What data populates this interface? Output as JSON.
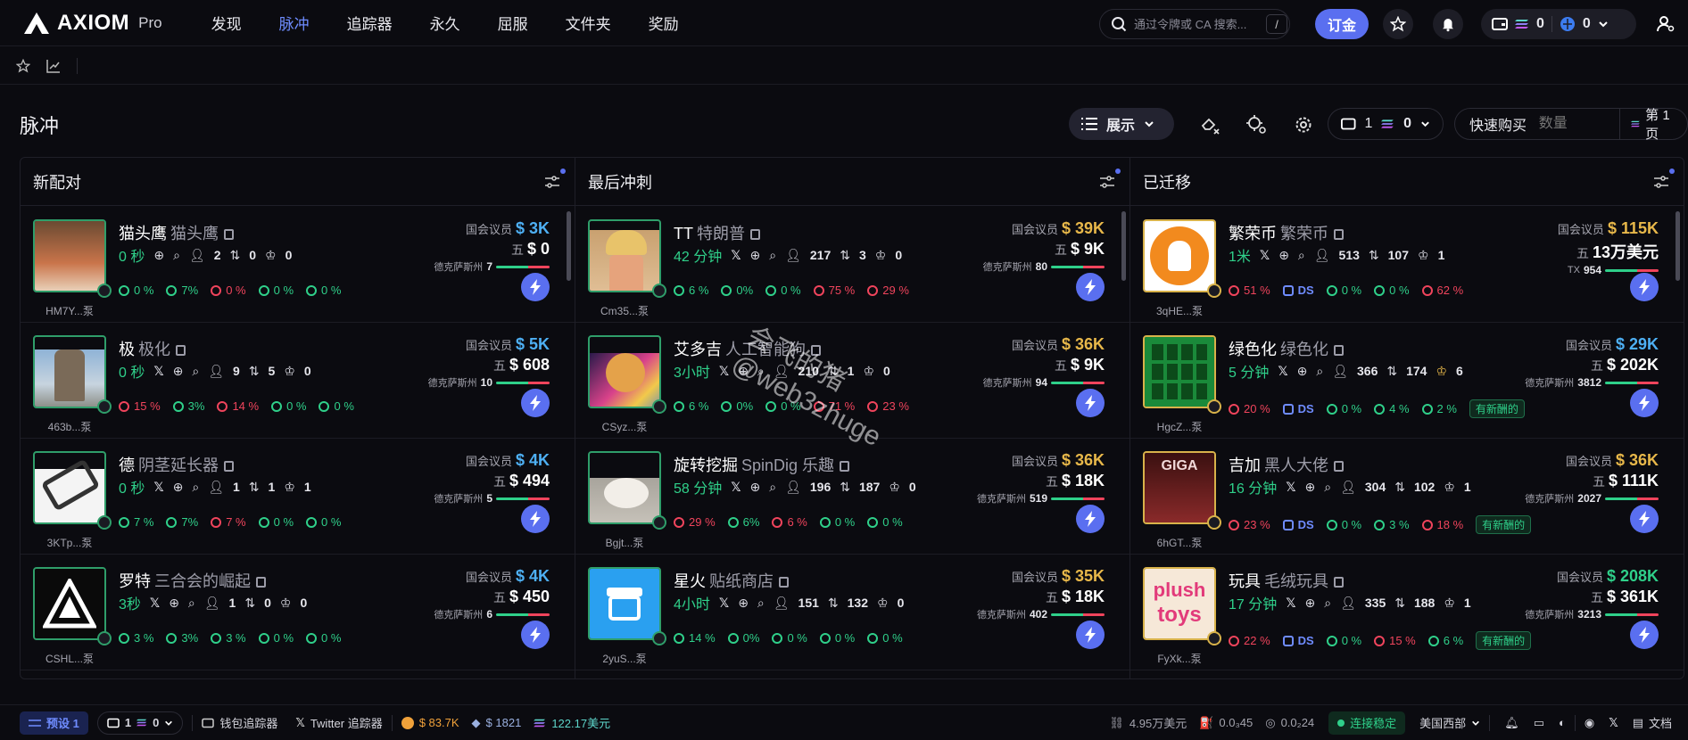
{
  "brand": {
    "name": "AXIOM",
    "suffix": "Pro"
  },
  "nav": [
    "发现",
    "脉冲",
    "追踪器",
    "永久",
    "屈服",
    "文件夹",
    "奖励"
  ],
  "search": {
    "placeholder": "通过令牌或 CA 搜索...",
    "shortcut": "/"
  },
  "header": {
    "deposit": "订金",
    "wallet_sol": "0",
    "wallet_other": "0"
  },
  "page": {
    "title": "脉冲",
    "display": "展示",
    "preset_count": "1",
    "preset_sol": "0",
    "quick_buy": "快速购买",
    "qty_placeholder": "数量",
    "page_label": "第 1 页"
  },
  "columns": [
    {
      "title": "新配对"
    },
    {
      "title": "最后冲刺"
    },
    {
      "title": "已迁移"
    }
  ],
  "cards": {
    "c0": [
      {
        "sym": "猫头鹰",
        "full": "猫头鹰",
        "age": "0 秒",
        "holders": "2",
        "a": "0",
        "b": "0",
        "cap": "HM7Y...泵",
        "mc_label": "国会议员",
        "mc": "$ 3K",
        "vol_label": "五",
        "vol": "$ 0",
        "tx_label": "德克萨斯州",
        "tx": "7",
        "p": [
          "0 %",
          "7%",
          "0 %",
          "0 %",
          "0 %"
        ]
      },
      {
        "sym": "极",
        "full": "极化",
        "age": "0 秒",
        "holders": "9",
        "a": "5",
        "b": "0",
        "cap": "463b...泵",
        "mc_label": "国会议员",
        "mc": "$ 5K",
        "vol_label": "五",
        "vol": "$ 608",
        "tx_label": "德克萨斯州",
        "tx": "10",
        "p": [
          "15 %",
          "3%",
          "14 %",
          "0 %",
          "0 %"
        ]
      },
      {
        "sym": "德",
        "full": "阴茎延长器",
        "age": "0 秒",
        "holders": "1",
        "a": "1",
        "b": "1",
        "cap": "3KTp...泵",
        "mc_label": "国会议员",
        "mc": "$ 4K",
        "vol_label": "五",
        "vol": "$ 494",
        "tx_label": "德克萨斯州",
        "tx": "5",
        "p": [
          "7 %",
          "7%",
          "7 %",
          "0 %",
          "0 %"
        ]
      },
      {
        "sym": "罗特",
        "full": "三合会的崛起",
        "age": "3秒",
        "holders": "1",
        "a": "0",
        "b": "0",
        "cap": "CSHL...泵",
        "mc_label": "国会议员",
        "mc": "$ 4K",
        "vol_label": "五",
        "vol": "$ 450",
        "tx_label": "德克萨斯州",
        "tx": "6",
        "p": [
          "3 %",
          "3%",
          "3 %",
          "0 %",
          "0 %"
        ]
      }
    ],
    "c1": [
      {
        "sym": "TT",
        "full": "特朗普",
        "age": "42 分钟",
        "holders": "217",
        "a": "3",
        "b": "0",
        "cap": "Cm35...泵",
        "mc_label": "国会议员",
        "mc": "$ 39K",
        "vol_label": "五",
        "vol": "$ 9K",
        "tx_label": "德克萨斯州",
        "tx": "80",
        "p": [
          "6 %",
          "0%",
          "0 %",
          "75 %",
          "29 %"
        ]
      },
      {
        "sym": "艾多吉",
        "full": "人工智能狗",
        "age": "3小时",
        "holders": "210",
        "a": "1",
        "b": "0",
        "cap": "CSyz...泵",
        "mc_label": "国会议员",
        "mc": "$ 36K",
        "vol_label": "五",
        "vol": "$ 9K",
        "tx_label": "德克萨斯州",
        "tx": "94",
        "p": [
          "6 %",
          "0%",
          "0 %",
          "71 %",
          "23 %"
        ]
      },
      {
        "sym": "旋转挖掘",
        "full": "SpinDig 乐趣",
        "age": "58 分钟",
        "holders": "196",
        "a": "187",
        "b": "0",
        "cap": "Bgjt...泵",
        "mc_label": "国会议员",
        "mc": "$ 36K",
        "vol_label": "五",
        "vol": "$ 18K",
        "tx_label": "德克萨斯州",
        "tx": "519",
        "p": [
          "29 %",
          "6%",
          "6 %",
          "0 %",
          "0 %"
        ]
      },
      {
        "sym": "星火",
        "full": "贴纸商店",
        "age": "4小时",
        "holders": "151",
        "a": "132",
        "b": "0",
        "cap": "2yuS...泵",
        "mc_label": "国会议员",
        "mc": "$ 35K",
        "vol_label": "五",
        "vol": "$ 18K",
        "tx_label": "德克萨斯州",
        "tx": "402",
        "p": [
          "14 %",
          "0%",
          "0 %",
          "0 %",
          "0 %"
        ]
      }
    ],
    "c2": [
      {
        "sym": "繁荣币",
        "full": "繁荣币",
        "age": "1米",
        "holders": "513",
        "a": "107",
        "b": "1",
        "cap": "3qHE...泵",
        "mc_label": "国会议员",
        "mc": "$ 115K",
        "vol_label": "五",
        "vol": "13万美元",
        "tx_label": "TX",
        "tx": "954",
        "p": [
          "51 %",
          "DS",
          "0 %",
          "0 %",
          "62 %"
        ],
        "newtag": ""
      },
      {
        "sym": "绿色化",
        "full": "绿色化",
        "age": "5 分钟",
        "holders": "366",
        "a": "174",
        "b": "6",
        "cap": "HgcZ...泵",
        "mc_label": "国会议员",
        "mc": "$ 29K",
        "vol_label": "五",
        "vol": "$ 202K",
        "tx_label": "德克萨斯州",
        "tx": "3812",
        "p": [
          "20 %",
          "DS",
          "0 %",
          "4 %",
          "2 %"
        ],
        "newtag": "有新酬的"
      },
      {
        "sym": "吉加",
        "full": "黑人大佬",
        "age": "16 分钟",
        "holders": "304",
        "a": "102",
        "b": "1",
        "cap": "6hGT...泵",
        "mc_label": "国会议员",
        "mc": "$ 36K",
        "vol_label": "五",
        "vol": "$ 111K",
        "tx_label": "德克萨斯州",
        "tx": "2027",
        "p": [
          "23 %",
          "DS",
          "0 %",
          "3 %",
          "18 %"
        ],
        "newtag": "有新酬的"
      },
      {
        "sym": "玩具",
        "full": "毛绒玩具",
        "age": "17 分钟",
        "holders": "335",
        "a": "188",
        "b": "1",
        "cap": "FyXk...泵",
        "mc_label": "国会议员",
        "mc": "$ 208K",
        "vol_label": "五",
        "vol": "$ 361K",
        "tx_label": "德克萨斯州",
        "tx": "3213",
        "p": [
          "22 %",
          "DS",
          "0 %",
          "15 %",
          "6 %"
        ],
        "newtag": "有新酬的"
      }
    ]
  },
  "thumb_text": {
    "toys1": "plush",
    "toys2": "toys",
    "giga": "GIGA"
  },
  "watermark": {
    "line1": "会飞的猪",
    "line2": "@web3zhuge"
  },
  "footer": {
    "preset": "预设 1",
    "count": "1",
    "sol": "0",
    "wallet_tracker": "钱包追踪器",
    "twitter_tracker": "Twitter 追踪器",
    "btc": "$ 83.7K",
    "eth": "$ 1821",
    "sol_price": "122.17美元",
    "fee": "4.95万美元",
    "gas1": "0.0₃45",
    "gas2": "0.0₂24",
    "connection": "连接稳定",
    "region": "美国西部",
    "docs": "文档"
  },
  "colors": {
    "accent": "#5a6ff0",
    "green": "#2fd08a",
    "red": "#f0445c",
    "gold": "#e8b84a",
    "blue": "#4eb0f4"
  }
}
